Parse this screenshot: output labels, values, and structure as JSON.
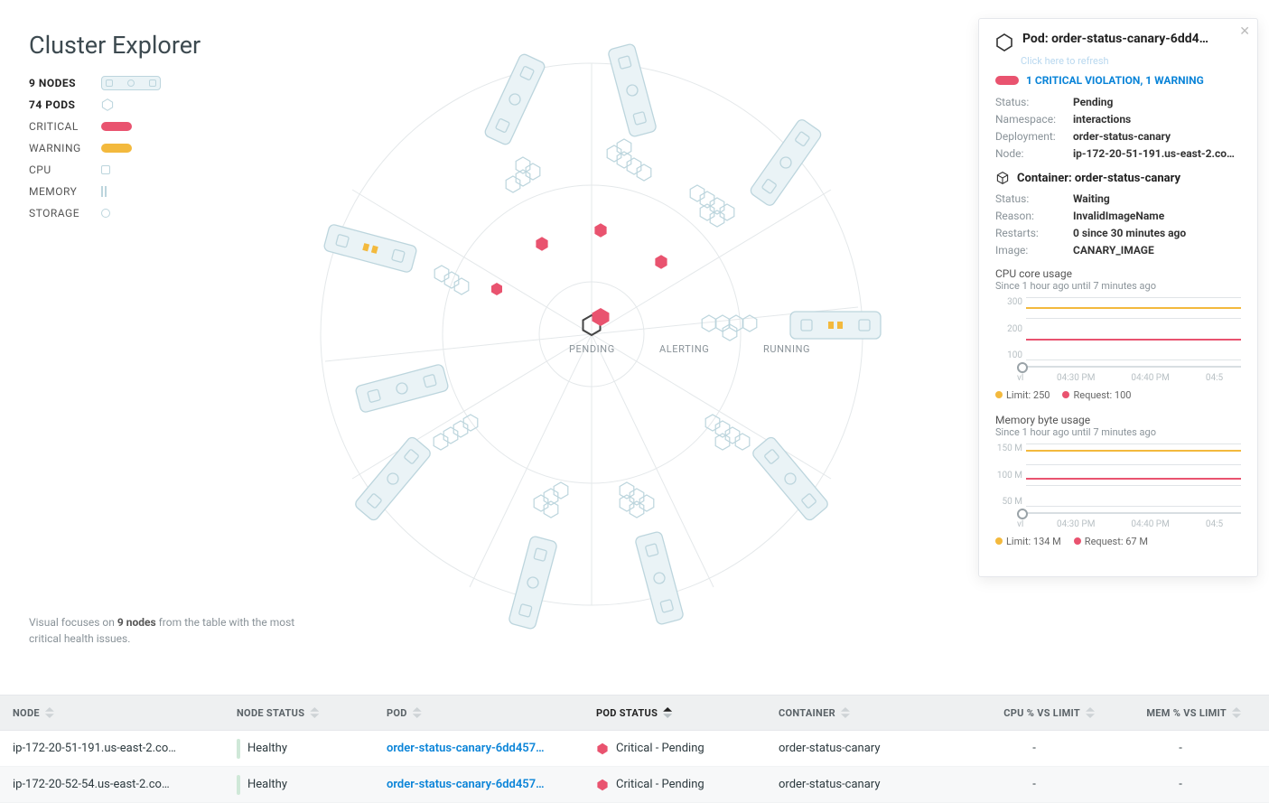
{
  "page": {
    "title": "Cluster Explorer",
    "footer_note_pre": "Visual focuses on ",
    "footer_note_bold": "9 nodes",
    "footer_note_post": " from the table with the most critical health issues."
  },
  "legend": {
    "nodes": {
      "label": "9 NODES"
    },
    "pods": {
      "label": "74 PODS"
    },
    "critical": {
      "label": "CRITICAL"
    },
    "warning": {
      "label": "WARNING"
    },
    "cpu": {
      "label": "CPU"
    },
    "memory": {
      "label": "MEMORY"
    },
    "storage": {
      "label": "STORAGE"
    }
  },
  "radial": {
    "pending": "PENDING",
    "alerting": "ALERTING",
    "running": "RUNNING"
  },
  "panel": {
    "pod_label_prefix": "Pod: ",
    "pod_name": "order-status-canary-6dd4…",
    "refresh": "Click here to refresh",
    "violations": "1 CRITICAL VIOLATION, 1 WARNING",
    "pod_kv": {
      "status_k": "Status:",
      "status_v": "Pending",
      "ns_k": "Namespace:",
      "ns_v": "interactions",
      "dep_k": "Deployment:",
      "dep_v": "order-status-canary",
      "node_k": "Node:",
      "node_v": "ip-172-20-51-191.us-east-2.com…"
    },
    "container_label_prefix": "Container: ",
    "container_name": "order-status-canary",
    "container_kv": {
      "status_k": "Status:",
      "status_v": "Waiting",
      "reason_k": "Reason:",
      "reason_v": "InvalidImageName",
      "restarts_k": "Restarts:",
      "restarts_v": "0 since 30 minutes ago",
      "image_k": "Image:",
      "image_v": "CANARY_IMAGE"
    },
    "cpu": {
      "title": "CPU core usage",
      "sub": "Since 1 hour ago until 7 minutes ago",
      "ylabels": [
        "300",
        "200",
        "100"
      ],
      "xlabels": [
        "vl",
        "04:30 PM",
        "04:40 PM",
        "04:5"
      ],
      "legend_limit": "Limit: 250",
      "legend_request": "Request: 100"
    },
    "mem": {
      "title": "Memory byte usage",
      "sub": "Since 1 hour ago until 7 minutes ago",
      "ylabels": [
        "150 M",
        "100 M",
        "50 M"
      ],
      "xlabels": [
        "vl",
        "04:30 PM",
        "04:40 PM",
        "04:5"
      ],
      "legend_limit": "Limit: 134 M",
      "legend_request": "Request: 67 M"
    }
  },
  "chart_data": [
    {
      "type": "line",
      "title": "CPU core usage",
      "sub": "Since 1 hour ago until 7 minutes ago",
      "ylim": [
        0,
        300
      ],
      "yticks": [
        100,
        200,
        300
      ],
      "x_tick_labels": [
        "04:30 PM",
        "04:40 PM",
        "04:5"
      ],
      "series": [
        {
          "name": "Limit",
          "constant_value": 250,
          "color": "#f3b93d"
        },
        {
          "name": "Request",
          "constant_value": 100,
          "color": "#e9536f"
        }
      ],
      "legend": [
        "Limit: 250",
        "Request: 100"
      ]
    },
    {
      "type": "line",
      "title": "Memory byte usage",
      "sub": "Since 1 hour ago until 7 minutes ago",
      "ylim": [
        0,
        150
      ],
      "yunit": "M",
      "yticks": [
        50,
        100,
        150
      ],
      "x_tick_labels": [
        "04:30 PM",
        "04:40 PM",
        "04:5"
      ],
      "series": [
        {
          "name": "Limit",
          "constant_value": 134,
          "color": "#f3b93d"
        },
        {
          "name": "Request",
          "constant_value": 67,
          "color": "#e9536f"
        }
      ],
      "legend": [
        "Limit: 134 M",
        "Request: 67 M"
      ]
    }
  ],
  "table": {
    "cols": {
      "node": "NODE",
      "node_status": "NODE STATUS",
      "pod": "POD",
      "pod_status": "POD STATUS",
      "container": "CONTAINER",
      "cpu": "CPU % VS LIMIT",
      "mem": "MEM % VS LIMIT"
    },
    "rows": [
      {
        "node": "ip-172-20-51-191.us-east-2.co…",
        "node_status": "Healthy",
        "pod": "order-status-canary-6dd457…",
        "pod_status": "Critical - Pending",
        "container": "order-status-canary",
        "cpu": "-",
        "mem": "-"
      },
      {
        "node": "ip-172-20-52-54.us-east-2.co…",
        "node_status": "Healthy",
        "pod": "order-status-canary-6dd457…",
        "pod_status": "Critical - Pending",
        "container": "order-status-canary",
        "cpu": "-",
        "mem": "-"
      }
    ]
  }
}
